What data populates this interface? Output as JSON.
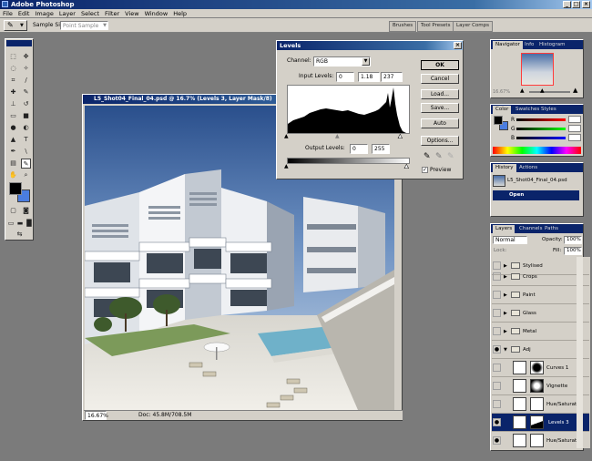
{
  "app": {
    "title": "Adobe Photoshop"
  },
  "menu": [
    "File",
    "Edit",
    "Image",
    "Layer",
    "Select",
    "Filter",
    "View",
    "Window",
    "Help"
  ],
  "options_bar": {
    "sample_size_label": "Sample Size:",
    "sample_size_value": "Point Sample",
    "palette_well": [
      "Brushes",
      "Tool Presets",
      "Layer Comps"
    ]
  },
  "document": {
    "title": "L5_Shot04_Final_04.psd @ 16.7% (Levels 3, Layer Mask/8)",
    "zoom": "16.67%",
    "doc_info": "Doc: 45.8M/708.5M"
  },
  "levels": {
    "title": "Levels",
    "channel_label": "Channel:",
    "channel_value": "RGB",
    "input_label": "Input Levels:",
    "input_values": [
      "0",
      "1.18",
      "237"
    ],
    "output_label": "Output Levels:",
    "output_values": [
      "0",
      "255"
    ],
    "buttons": [
      "OK",
      "Cancel",
      "Load...",
      "Save...",
      "Auto",
      "Options..."
    ],
    "preview_label": "Preview",
    "preview_checked": true
  },
  "navigator": {
    "tabs": [
      "Navigator",
      "Info",
      "Histogram"
    ],
    "zoom": "16.67%"
  },
  "color": {
    "tabs": [
      "Color",
      "Swatches",
      "Styles"
    ],
    "channels": [
      "R",
      "G",
      "B"
    ]
  },
  "history": {
    "tabs": [
      "History",
      "Actions"
    ],
    "snapshot": "L5_Shot04_Final_04.psd",
    "items": [
      "Open"
    ]
  },
  "layers": {
    "tabs": [
      "Layers",
      "Channels",
      "Paths"
    ],
    "blend_mode": "Normal",
    "opacity_label": "Opacity:",
    "opacity": "100%",
    "lock_label": "Lock:",
    "fill_label": "Fill:",
    "fill": "100%",
    "rows": [
      {
        "name": "Stylised",
        "type": "group"
      },
      {
        "name": "Crops",
        "type": "group"
      },
      {
        "name": "Paint",
        "type": "group"
      },
      {
        "name": "Glass",
        "type": "group"
      },
      {
        "name": "Metal",
        "type": "group"
      },
      {
        "name": "Adj",
        "type": "group-open"
      },
      {
        "name": "Curves 1",
        "type": "adjustment"
      },
      {
        "name": "Vignette",
        "type": "adjustment"
      },
      {
        "name": "Hue/Saturati...",
        "type": "adjustment"
      },
      {
        "name": "Levels 3",
        "type": "adjustment",
        "selected": true
      },
      {
        "name": "Hue/Saturati...",
        "type": "adjustment"
      }
    ]
  },
  "colors": {
    "title_blue": "#0a246a",
    "chrome": "#d4d0c8",
    "workspace": "#7b7b7b",
    "selection": "#0a246a"
  }
}
